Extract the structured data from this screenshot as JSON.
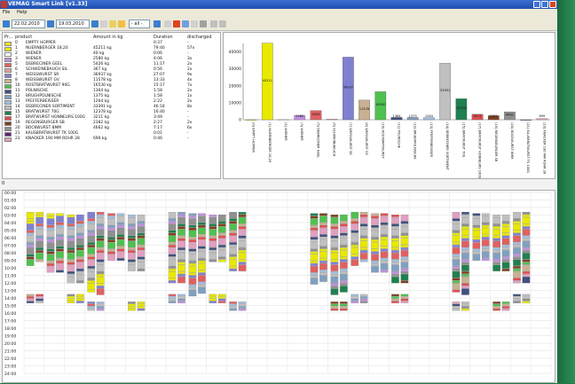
{
  "window": {
    "title": "VEMAG Smart Link [v1.33]"
  },
  "menu": [
    "File",
    "Help"
  ],
  "toolbar": {
    "date_from": "22.02.2010",
    "date_to": "19.03.2010",
    "filter": "- all -"
  },
  "product_table": {
    "headers": [
      "Pr...",
      "product",
      "Amount in kg",
      "Duration",
      "discharged"
    ],
    "rows": [
      {
        "nr": "0",
        "product": "EMPTY HOPPER",
        "amount": "",
        "duration": "0:37",
        "discharged": "-",
        "color": "#f0e020"
      },
      {
        "nr": "1",
        "product": "NUERNBERGER 18,20",
        "amount": "45211 kg",
        "duration": "79:40",
        "discharged": "57x",
        "color": "#e8e800"
      },
      {
        "nr": "2",
        "product": "WIENER",
        "amount": "40 kg",
        "duration": "0:06",
        "discharged": "-",
        "color": "#ffffff"
      },
      {
        "nr": "3",
        "product": "WIENER",
        "amount": "2580 kg",
        "duration": "4:06",
        "discharged": "3x",
        "color": "#c090e0"
      },
      {
        "nr": "5",
        "product": "DEBRECINER GEEL",
        "amount": "5426 kg",
        "duration": "11:17",
        "discharged": "2x",
        "color": "#e06060"
      },
      {
        "nr": "6",
        "product": "SCHWEINEBAUCH SIL",
        "amount": "367 kg",
        "duration": "0:56",
        "discharged": "2x",
        "color": "#e0a0a0"
      },
      {
        "nr": "7",
        "product": "WEISSWURST SR",
        "amount": "36937 kg",
        "duration": "27:07",
        "discharged": "9x",
        "color": "#8080d0"
      },
      {
        "nr": "8",
        "product": "WEISSWURST GV",
        "amount": "11578 kg",
        "duration": "13:33",
        "discharged": "4x",
        "color": "#c8b090"
      },
      {
        "nr": "10",
        "product": "ROSTBRATWURST 90G",
        "amount": "16530 kg",
        "duration": "15:17",
        "discharged": "7x",
        "color": "#50c050"
      },
      {
        "nr": "11",
        "product": "POLNISCHE",
        "amount": "1364 kg",
        "duration": "1:58",
        "discharged": "2x",
        "color": "#405080"
      },
      {
        "nr": "12",
        "product": "BRUEHPOLNISCHE",
        "amount": "1375 kg",
        "duration": "1:58",
        "discharged": "1x",
        "color": "#80a0c0"
      },
      {
        "nr": "13",
        "product": "PFEFFERBEISSER",
        "amount": "1264 kg",
        "duration": "2:22",
        "discharged": "2x",
        "color": "#a0c0e0"
      },
      {
        "nr": "14",
        "product": "DEBRECINER SORTIMENT",
        "amount": "33391 kg",
        "duration": "46:18",
        "discharged": "8x",
        "color": "#c0c0c0"
      },
      {
        "nr": "15",
        "product": "BRATWURST 70G",
        "amount": "12378 kg",
        "duration": "16:40",
        "discharged": "-",
        "color": "#208050"
      },
      {
        "nr": "17",
        "product": "BRATWURST HONNEURS 100G",
        "amount": "3211 kg",
        "duration": "3:49",
        "discharged": "-",
        "color": "#e05050"
      },
      {
        "nr": "19",
        "product": "REGENSBURGER SB",
        "amount": "2382 kg",
        "duration": "2:27",
        "discharged": "2x",
        "color": "#804020"
      },
      {
        "nr": "20",
        "product": "BOCKWURST 8MM",
        "amount": "4662 kg",
        "duration": "7:17",
        "discharged": "6x",
        "color": "#909090"
      },
      {
        "nr": "21",
        "product": "KAUSBRATWURST TK 100G",
        "amount": "",
        "duration": "0:01",
        "discharged": "-",
        "color": "#602080"
      },
      {
        "nr": "23",
        "product": "KNACKER 190 MM ROHR 28",
        "amount": "699 kg",
        "duration": "0:46",
        "discharged": "-",
        "color": "#e0a0c0"
      }
    ]
  },
  "chart_data": {
    "type": "bar",
    "ylim": [
      0,
      45000
    ],
    "yticks": [
      "0",
      "10000",
      "20000",
      "30000",
      "40000"
    ],
    "categories": [
      "(0) EMPTY HOPPER",
      "(1) NUERNBERGER 18,20",
      "(2) WIENER",
      "(3) WIENER",
      "(5) DEBRECINER GEEL",
      "(6) SCHWEINEBAUCH",
      "(7) WEISSWURST SR",
      "(8) WEISSWURST GV",
      "(10) ROSTBRATWURST",
      "(11) POLNISCHE",
      "(12) BRUEHPOLNISCHE",
      "(13) PFEFFERBEISSER",
      "(14) DEBRECINER SORTIMENT",
      "(15) BRATWURST 70G",
      "(17) BRATWURST HONNEURS 100G",
      "(19) REGENSBURGER SB",
      "(20) BOCKWURST 8MM",
      "(21) KAUSBRATWURST TK 100G",
      "(23) KNACKER 190 MM ROHR 28"
    ],
    "values": [
      0,
      45211,
      40,
      2580,
      5426,
      367,
      36937,
      11578,
      16530,
      1364,
      1375,
      1264,
      33391,
      12378,
      3211,
      2382,
      4662,
      0,
      699
    ],
    "value_labels": [
      "",
      "45211",
      "",
      "2580",
      "5426",
      "",
      "36937",
      "11578",
      "16530",
      "1364",
      "1375",
      "1264",
      "33391",
      "12378",
      "3211",
      "2382",
      "4662",
      "",
      "699"
    ],
    "colors": [
      "#f0e020",
      "#e8e800",
      "#ffffff",
      "#c090e0",
      "#e06060",
      "#e0a0a0",
      "#8080d0",
      "#c8b090",
      "#50c050",
      "#405080",
      "#80a0c0",
      "#a0c0e0",
      "#c0c0c0",
      "#208050",
      "#e05050",
      "#804020",
      "#909090",
      "#602080",
      "#e0a0c0"
    ]
  },
  "timeline": {
    "hours": [
      "00:00",
      "01:00",
      "02:00",
      "03:00",
      "04:00",
      "05:00",
      "06:00",
      "07:00",
      "08:00",
      "09:00",
      "10:00",
      "11:00",
      "12:00",
      "13:00",
      "14:00",
      "15:00",
      "16:00",
      "17:00",
      "18:00",
      "19:00",
      "20:00",
      "21:00",
      "22:00",
      "23:00",
      "24:00"
    ],
    "scroll_value": "0"
  }
}
